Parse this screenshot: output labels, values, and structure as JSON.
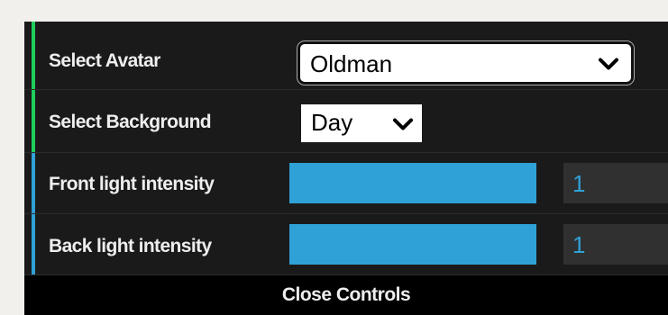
{
  "controls": {
    "avatar": {
      "label": "Select Avatar",
      "value": "Oldman"
    },
    "background": {
      "label": "Select Background",
      "value": "Day"
    },
    "front_light": {
      "label": "Front light intensity",
      "value": "1"
    },
    "back_light": {
      "label": "Back light intensity",
      "value": "1"
    }
  },
  "close_label": "Close Controls",
  "colors": {
    "panel": "#1a1a1a",
    "accent": "#2fa1d6",
    "select_row_marker": "#1fcf5a",
    "number_bg": "#303030",
    "page_bg": "#f2f0ec"
  },
  "icons": [
    "chevron-down-icon"
  ]
}
